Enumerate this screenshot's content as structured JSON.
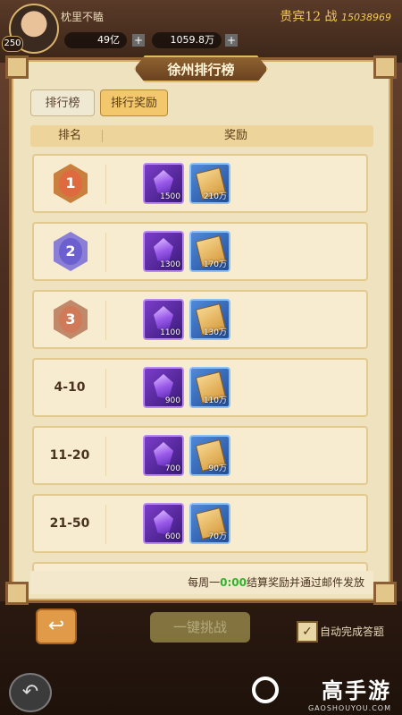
{
  "player": {
    "name": "枕里不瞌",
    "level": "250",
    "vip": "贵宾12",
    "power_icon": "战",
    "power": "15038969"
  },
  "resources": [
    {
      "icon": "coin-icon",
      "value": "49亿"
    },
    {
      "icon": "ingot-icon",
      "value": "1059.8万"
    }
  ],
  "panel": {
    "title": "徐州排行榜"
  },
  "tabs": [
    {
      "label": "排行榜",
      "active": false
    },
    {
      "label": "排行奖励",
      "active": true
    }
  ],
  "table": {
    "col_rank": "排名",
    "col_reward": "奖励"
  },
  "rows": [
    {
      "rank": "1",
      "medal": "gold",
      "gem_qty": "1500",
      "book_qty": "210万"
    },
    {
      "rank": "2",
      "medal": "silver",
      "gem_qty": "1300",
      "book_qty": "170万"
    },
    {
      "rank": "3",
      "medal": "bronze",
      "gem_qty": "1100",
      "book_qty": "130万"
    },
    {
      "rank": "4-10",
      "medal": "",
      "gem_qty": "900",
      "book_qty": "110万"
    },
    {
      "rank": "11-20",
      "medal": "",
      "gem_qty": "700",
      "book_qty": "90万"
    },
    {
      "rank": "21-50",
      "medal": "",
      "gem_qty": "600",
      "book_qty": "70万"
    },
    {
      "rank": "",
      "medal": "",
      "gem_qty": "",
      "book_qty": ""
    }
  ],
  "footer": {
    "prefix": "每周一",
    "time": "0:00",
    "suffix": "结算奖励并通过邮件发放"
  },
  "bottom": {
    "challenge": "一键挑战",
    "auto_label": "自动完成答题",
    "auto_checked": "✓"
  },
  "brand": {
    "name": "高手游",
    "domain": "GAOSHOUYOU.COM"
  }
}
